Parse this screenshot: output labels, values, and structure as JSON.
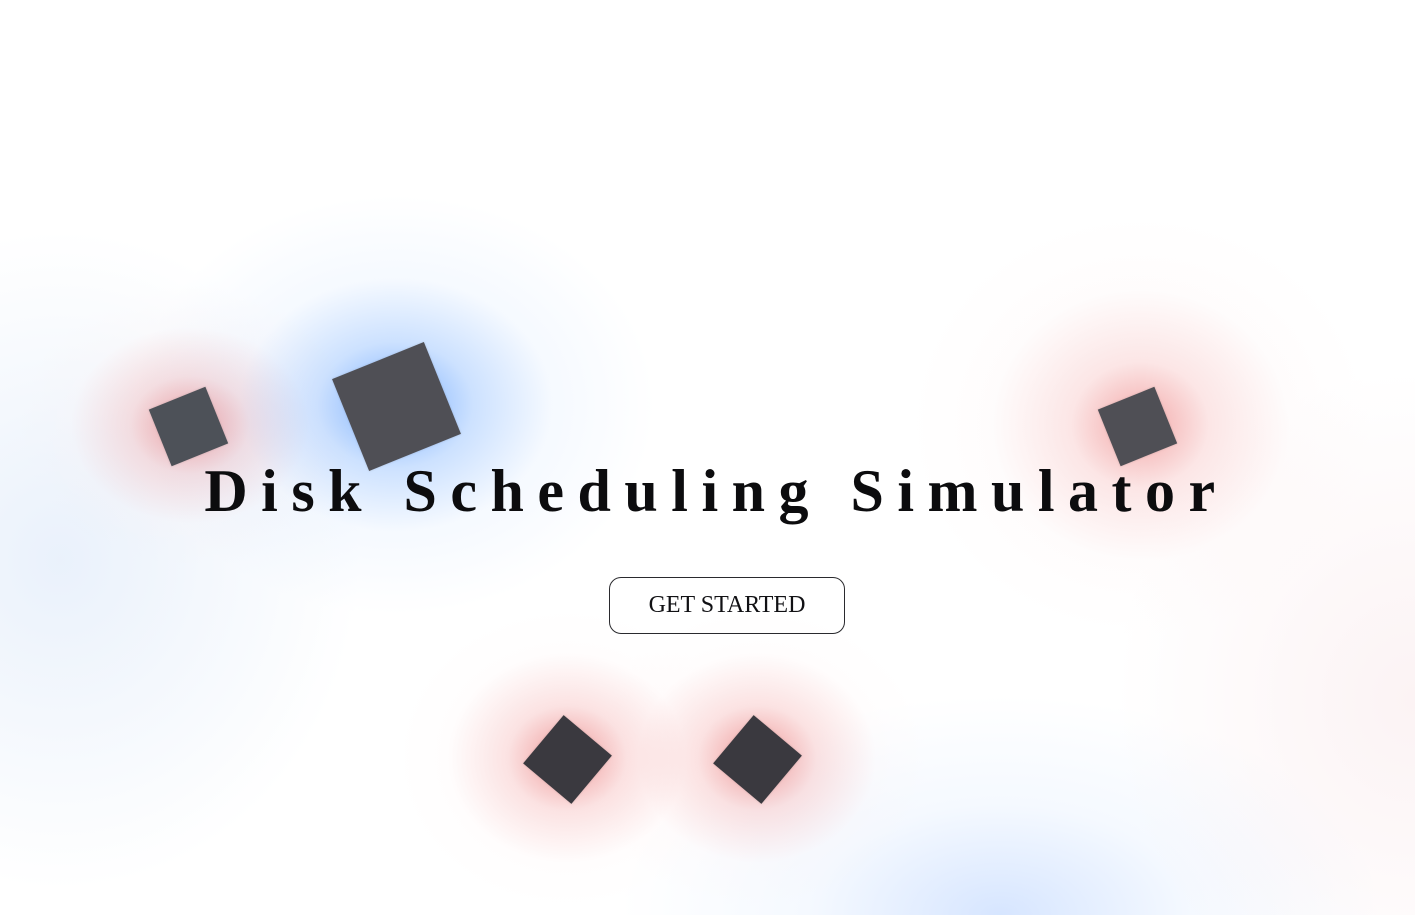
{
  "hero": {
    "title": "Disk Scheduling Simulator",
    "cta_label": "GET STARTED"
  },
  "theme": {
    "accent_blue": "#408cff",
    "accent_red": "#e65050",
    "square_color": "#4f4f55",
    "text_color": "#0c0c0e"
  }
}
